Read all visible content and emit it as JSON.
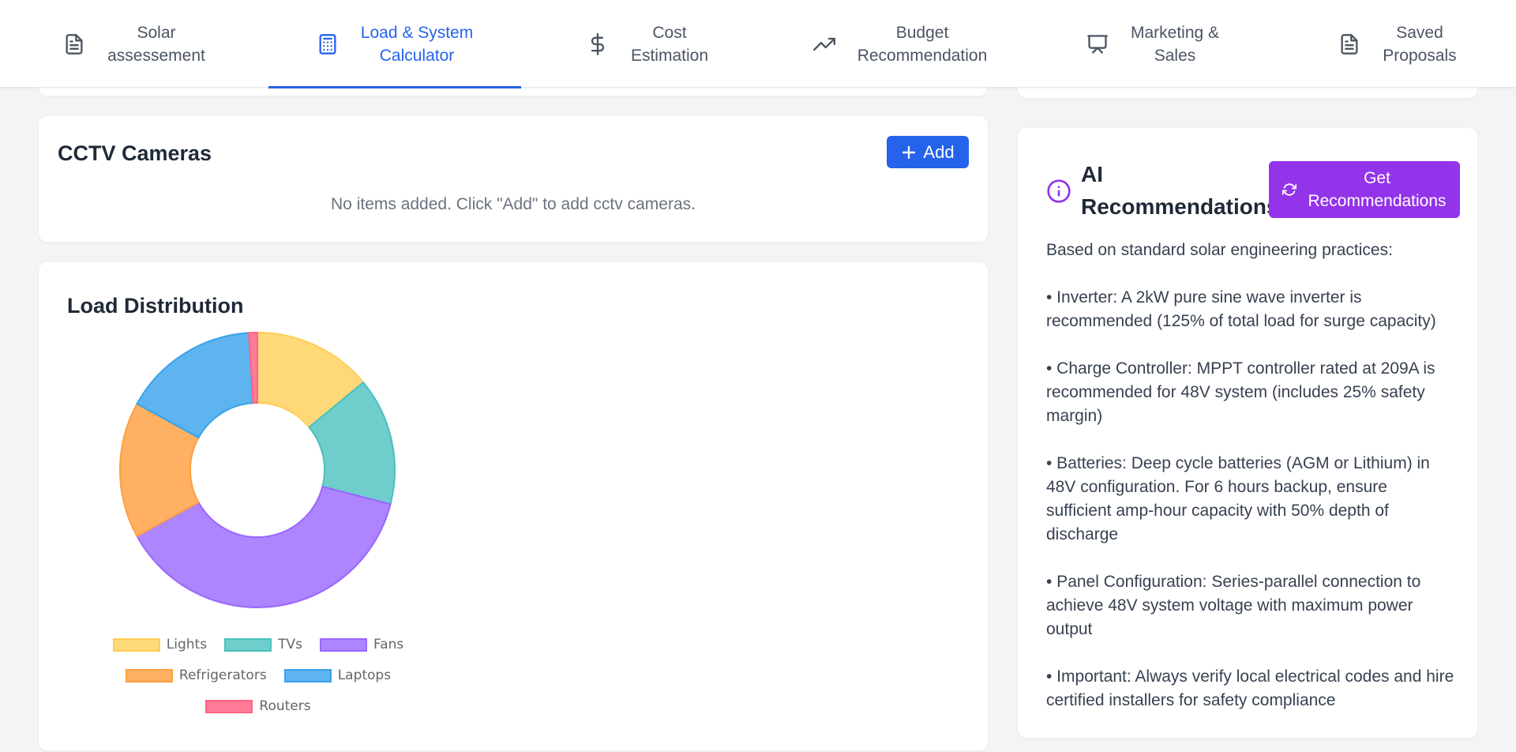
{
  "nav": {
    "tabs": [
      {
        "label": "Solar\nassessement",
        "icon": "file-text-icon",
        "active": false
      },
      {
        "label": "Load & System\nCalculator",
        "icon": "calculator-icon",
        "active": true
      },
      {
        "label": "Cost\nEstimation",
        "icon": "dollar-icon",
        "active": false
      },
      {
        "label": "Budget\nRecommendation",
        "icon": "trending-up-icon",
        "active": false
      },
      {
        "label": "Marketing &\nSales",
        "icon": "presentation-icon",
        "active": false
      },
      {
        "label": "Saved\nProposals",
        "icon": "file-text-icon",
        "active": false
      }
    ]
  },
  "cctv": {
    "title": "CCTV Cameras",
    "add_label": "Add",
    "empty_message": "No items added. Click \"Add\" to add cctv cameras."
  },
  "load_distribution": {
    "title": "Load Distribution"
  },
  "chart_data": {
    "type": "pie",
    "variant": "doughnut",
    "categories": [
      "Lights",
      "TVs",
      "Fans",
      "Refrigerators",
      "Laptops",
      "Routers"
    ],
    "values": [
      14,
      15,
      38,
      16,
      16,
      1
    ],
    "colors": {
      "fill": [
        "#ffd978",
        "#6fcdcc",
        "#ad85ff",
        "#ffb062",
        "#5eb4ef",
        "#ff7b97"
      ],
      "border": [
        "#ffcd56",
        "#4bc0c0",
        "#9966ff",
        "#ff9f40",
        "#36a2eb",
        "#ff6384"
      ]
    },
    "legend": "bottom",
    "title": "",
    "xlabel": "",
    "ylabel": ""
  },
  "ai": {
    "title": "AI\nRecommendations",
    "button_label": "Get\nRecommendations",
    "icon": "info-icon",
    "intro": "Based on standard solar engineering practices:",
    "items": [
      "• Inverter: A 2kW pure sine wave inverter is recommended (125% of total load for surge capacity)",
      "• Charge Controller: MPPT controller rated at 209A is recommended for 48V system (includes 25% safety margin)",
      "• Batteries: Deep cycle batteries (AGM or Lithium) in 48V configuration. For 6 hours backup, ensure sufficient amp-hour capacity with 50% depth of discharge",
      "• Panel Configuration: Series-parallel connection to achieve 48V system voltage with maximum power output",
      "• Important: Always verify local electrical codes and hire certified installers for safety compliance"
    ]
  },
  "accent": {
    "primary": "#2563eb",
    "ai": "#9333ea"
  }
}
